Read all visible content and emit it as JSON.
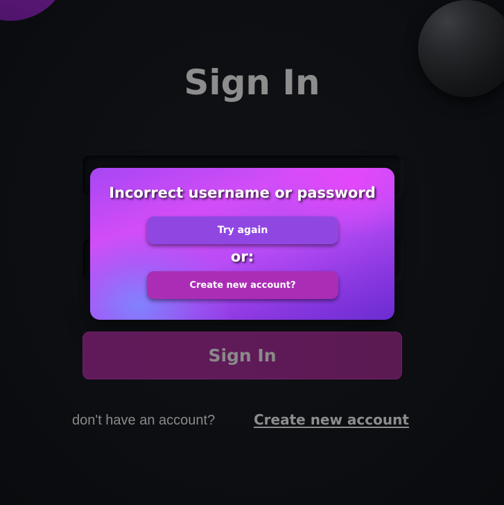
{
  "page": {
    "title": "Sign In"
  },
  "form": {
    "submit_label": "Sign In"
  },
  "error_dialog": {
    "message": "Incorrect username or password",
    "retry_label": "Try again",
    "separator": "or:",
    "create_account_label": "Create new account?"
  },
  "footer": {
    "prompt": "don't have an account?",
    "link_label": "Create new account"
  },
  "colors": {
    "background": "#0c0e12",
    "accent_purple": "#b84cf6",
    "submit_button": "#611a59",
    "muted_text": "#8d8d8d"
  }
}
